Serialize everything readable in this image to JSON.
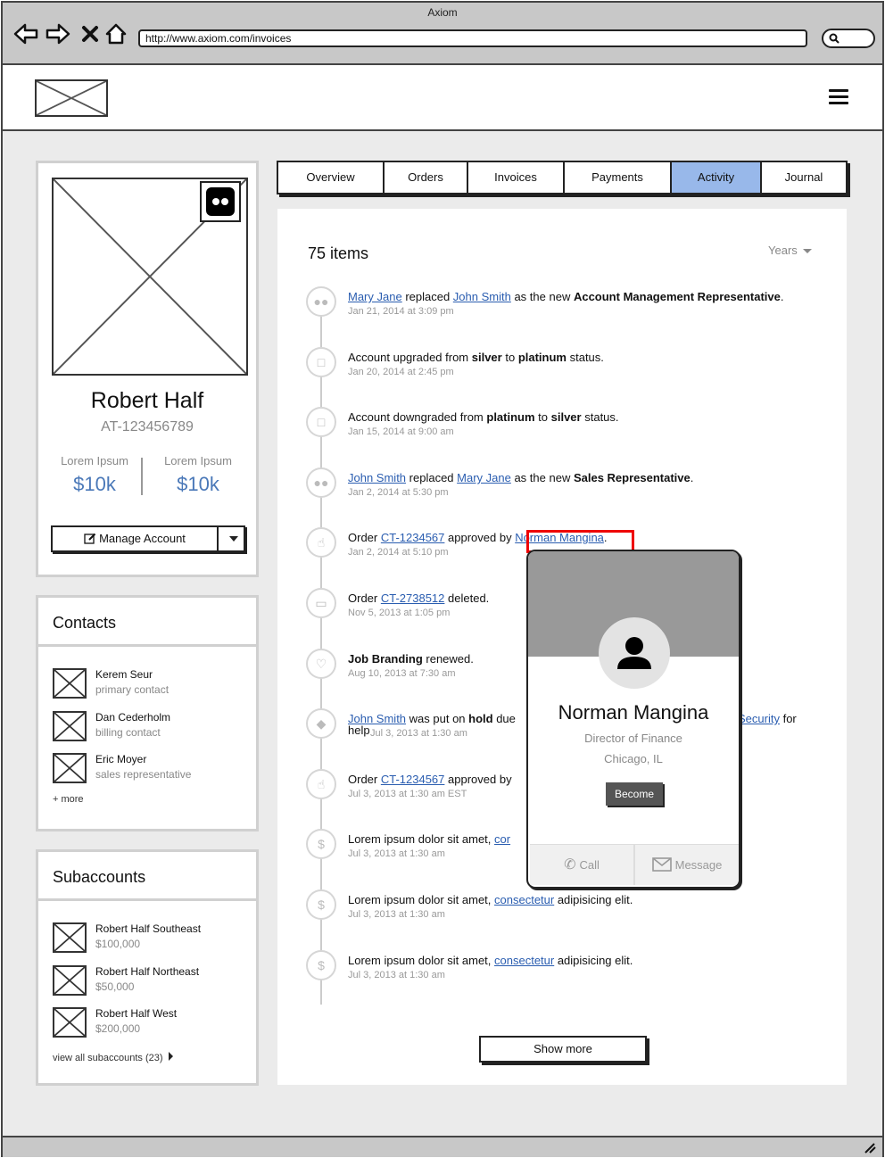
{
  "browser": {
    "window_title": "Axiom",
    "url": "http://www.axiom.com/invoices"
  },
  "profile": {
    "name": "Robert Half",
    "account_id": "AT-123456789",
    "stats": [
      {
        "label": "Lorem Ipsum",
        "value": "$10k"
      },
      {
        "label": "Lorem Ipsum",
        "value": "$10k"
      }
    ],
    "manage_label": "Manage Account"
  },
  "contacts": {
    "title": "Contacts",
    "items": [
      {
        "name": "Kerem Seur",
        "role": "primary contact"
      },
      {
        "name": "Dan Cederholm",
        "role": "billing contact"
      },
      {
        "name": "Eric Moyer",
        "role": "sales representative"
      }
    ],
    "more_label": "+ more"
  },
  "subaccounts": {
    "title": "Subaccounts",
    "items": [
      {
        "name": "Robert Half Southeast",
        "amount": "$100,000"
      },
      {
        "name": "Robert Half Northeast",
        "amount": "$50,000"
      },
      {
        "name": "Robert Half West",
        "amount": "$200,000"
      }
    ],
    "view_all_label": "view all subaccounts (23)"
  },
  "tabs": [
    "Overview",
    "Orders",
    "Invoices",
    "Payments",
    "Activity",
    "Journal"
  ],
  "active_tab": "Activity",
  "activity": {
    "count_label": "75 items",
    "filter_label": "Years",
    "feed": [
      {
        "icon": "group-icon",
        "time": "Jan 21, 2014 at 3:09 pm"
      },
      {
        "icon": "folder-icon",
        "time": "Jan 20, 2014 at 2:45 pm"
      },
      {
        "icon": "folder-icon",
        "time": "Jan 15, 2014 at 9:00 am"
      },
      {
        "icon": "group-icon",
        "time": "Jan 2, 2014 at 5:30 pm"
      },
      {
        "icon": "thumbs-up-icon",
        "time": "Jan 2, 2014 at 5:10 pm"
      },
      {
        "icon": "trash-icon",
        "time": "Nov 5, 2013 at 1:05 pm"
      },
      {
        "icon": "heart-icon",
        "time": "Aug 10, 2013 at 7:30 am"
      },
      {
        "icon": "lock-icon",
        "time": "Jul 3, 2013 at 1:30 am"
      },
      {
        "icon": "thumbs-up-icon",
        "time": "Jul 3, 2013 at 1:30 am EST"
      },
      {
        "icon": "dollar-icon",
        "time": "Jul 3, 2013 at 1:30 am"
      },
      {
        "icon": "dollar-icon",
        "time": "Jul 3, 2013 at 1:30 am"
      },
      {
        "icon": "dollar-icon",
        "time": "Jul 3, 2013 at 1:30 am"
      }
    ],
    "show_more_label": "Show more"
  },
  "feed_text": {
    "f0": {
      "a": "Mary Jane",
      "b": " replaced ",
      "c": "John Smith",
      "d": " as the new ",
      "e": "Account Management Representative",
      "f": "."
    },
    "f1": {
      "a": "Account upgraded from ",
      "b": "silver",
      "c": " to ",
      "d": "platinum",
      "e": " status."
    },
    "f2": {
      "a": "Account downgraded from ",
      "b": "platinum",
      "c": " to ",
      "d": "silver",
      "e": " status."
    },
    "f3": {
      "a": "John Smith",
      "b": " replaced ",
      "c": "Mary Jane",
      "d": " as the new ",
      "e": "Sales Representative",
      "f": "."
    },
    "f4": {
      "a": "Order ",
      "b": "CT-1234567",
      "c": " approved by ",
      "d": "Norman Mangina",
      "e": "."
    },
    "f5": {
      "a": "Order ",
      "b": "CT-2738512",
      "c": " deleted."
    },
    "f6": {
      "a": "Job Branding",
      "b": " renewed."
    },
    "f7": {
      "a": "John Smith",
      "b": " was put on ",
      "c": "hold",
      "d": " due",
      "e": "Security",
      "f": " for",
      "g": "help"
    },
    "f8": {
      "a": "Order ",
      "b": "CT-1234567",
      "c": " approved by"
    },
    "f9": {
      "a": "Lorem ipsum dolor sit amet, ",
      "b": "cor"
    },
    "f10": {
      "a": "Lorem ipsum dolor sit amet, ",
      "b": "consectetur",
      "c": " adipisicing elit."
    },
    "f11": {
      "a": "Lorem ipsum dolor sit amet, ",
      "b": "consectetur",
      "c": " adipisicing elit."
    }
  },
  "popover": {
    "name": "Norman Mangina",
    "title": "Director of Finance",
    "location": "Chicago, IL",
    "button_label": "Become",
    "call_label": "Call",
    "message_label": "Message"
  }
}
